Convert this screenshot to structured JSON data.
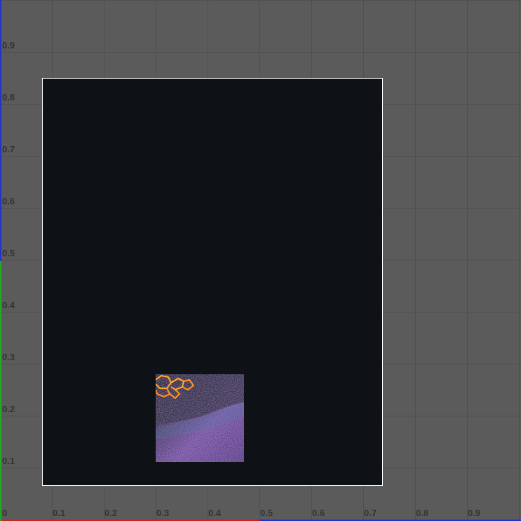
{
  "viewport": {
    "background_color": "#5b5b5b",
    "grid_color": "#4f4f4f"
  },
  "axes": {
    "x_ticks": [
      "0",
      "0.1",
      "0.2",
      "0.3",
      "0.4",
      "0.5",
      "0.6",
      "0.7",
      "0.8",
      "0.9"
    ],
    "y_ticks": [
      "0.1",
      "0.2",
      "0.3",
      "0.4",
      "0.5",
      "0.6",
      "0.7",
      "0.8",
      "0.9"
    ],
    "x_axis_colors": [
      "#cc2222",
      "#2233cc"
    ],
    "y_axis_colors": [
      "#22aa22",
      "#2233cc"
    ]
  },
  "canvas": {
    "fill_color": "#0e1216",
    "border_color": "#ffffff"
  },
  "image_tile": {
    "description_icon": "textured-image-tile",
    "dominant_colors": [
      "#5b3a8a",
      "#7a5aa6",
      "#2a2a3a",
      "#ff8c1a"
    ]
  }
}
